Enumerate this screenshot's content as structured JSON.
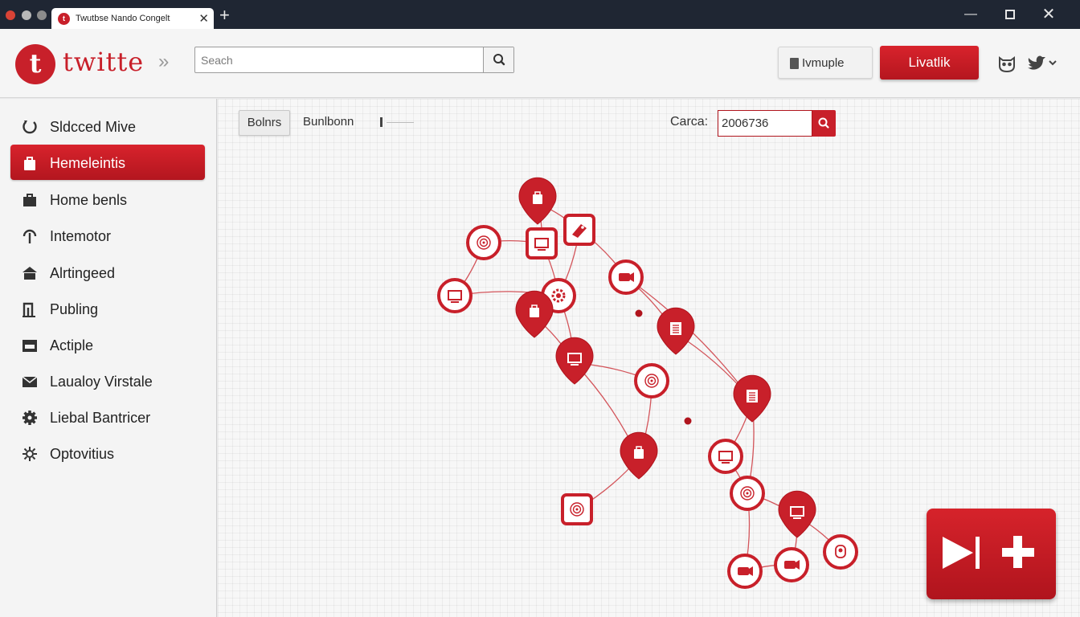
{
  "window": {
    "tab_title": "Twutbse Nando Congelt",
    "favicon_letter": "t",
    "close_glyph": "✕",
    "new_tab_glyph": "+",
    "minimize_glyph": "—"
  },
  "header": {
    "logo_letter": "t",
    "logo_text": "twitte",
    "chevrons": "»",
    "search_placeholder": "Seach",
    "grey_button_label": "Ivmuple",
    "red_button_label": "Livatlik",
    "icons": [
      "owl-icon",
      "bird-icon"
    ]
  },
  "sidebar": {
    "items": [
      {
        "label": "Sldcced Mive",
        "icon": "circle-arrow-icon",
        "active": false
      },
      {
        "label": "Hemeleintis",
        "icon": "bag-icon",
        "active": true
      },
      {
        "label": "Home benls",
        "icon": "briefcase-icon",
        "active": false
      },
      {
        "label": "Intemotor",
        "icon": "pin-icon",
        "active": false
      },
      {
        "label": "Alrtingeed",
        "icon": "house-icon",
        "active": false
      },
      {
        "label": "Publing",
        "icon": "chart-icon",
        "active": false
      },
      {
        "label": "Actiple",
        "icon": "tray-icon",
        "active": false
      },
      {
        "label": "Laualoy Virstale",
        "icon": "mail-icon",
        "active": false
      },
      {
        "label": "Liebal Bantricer",
        "icon": "gear-icon",
        "active": false
      },
      {
        "label": "Optovitius",
        "icon": "sun-icon",
        "active": false
      }
    ]
  },
  "toolbar": {
    "button_label": "Bolnrs",
    "label": "Bunlbonn",
    "category_label": "Carca:",
    "category_value": "2006736"
  },
  "graph": {
    "nodes": [
      {
        "id": "n1",
        "shape": "pin",
        "icon": "bag-icon"
      },
      {
        "id": "n2",
        "shape": "ring",
        "icon": "swirl-icon"
      },
      {
        "id": "n3",
        "shape": "square",
        "icon": "screen-icon"
      },
      {
        "id": "n4",
        "shape": "square",
        "icon": "tag-icon"
      },
      {
        "id": "n5",
        "shape": "ring",
        "icon": "screen-icon"
      },
      {
        "id": "n6",
        "shape": "ring",
        "icon": "gear-icon"
      },
      {
        "id": "n7",
        "shape": "ring",
        "icon": "camera-icon"
      },
      {
        "id": "n8",
        "shape": "pin",
        "icon": "bag-icon"
      },
      {
        "id": "n9",
        "shape": "pin",
        "icon": "document-icon"
      },
      {
        "id": "n10",
        "shape": "pin",
        "icon": "screen-icon"
      },
      {
        "id": "n11",
        "shape": "ring",
        "icon": "swirl-icon"
      },
      {
        "id": "n12",
        "shape": "pin",
        "icon": "document-icon"
      },
      {
        "id": "n13",
        "shape": "pin",
        "icon": "bag-icon"
      },
      {
        "id": "n14",
        "shape": "ring",
        "icon": "screen-icon"
      },
      {
        "id": "n15",
        "shape": "square",
        "icon": "swirl-icon"
      },
      {
        "id": "n16",
        "shape": "ring",
        "icon": "swirl-icon"
      },
      {
        "id": "n17",
        "shape": "pin",
        "icon": "screen-icon"
      },
      {
        "id": "n18",
        "shape": "ring",
        "icon": "user-icon"
      },
      {
        "id": "n19",
        "shape": "ring",
        "icon": "camera-icon"
      },
      {
        "id": "n20",
        "shape": "ring",
        "icon": "camera-icon"
      }
    ],
    "edges": [
      [
        "n1",
        "n3"
      ],
      [
        "n1",
        "n4"
      ],
      [
        "n2",
        "n3"
      ],
      [
        "n2",
        "n5"
      ],
      [
        "n3",
        "n6"
      ],
      [
        "n4",
        "n6"
      ],
      [
        "n4",
        "n7"
      ],
      [
        "n5",
        "n6"
      ],
      [
        "n6",
        "n8"
      ],
      [
        "n6",
        "n10"
      ],
      [
        "n7",
        "n9"
      ],
      [
        "n7",
        "n12"
      ],
      [
        "n8",
        "n10"
      ],
      [
        "n10",
        "n11"
      ],
      [
        "n10",
        "n13"
      ],
      [
        "n11",
        "n13"
      ],
      [
        "n13",
        "n15"
      ],
      [
        "n12",
        "n14"
      ],
      [
        "n12",
        "n16"
      ],
      [
        "n14",
        "n16"
      ],
      [
        "n16",
        "n17"
      ],
      [
        "n17",
        "n18"
      ],
      [
        "n17",
        "n20"
      ],
      [
        "n16",
        "n19"
      ],
      [
        "n19",
        "n20"
      ],
      [
        "n9",
        "n12"
      ]
    ]
  },
  "fab": {
    "icons": [
      "play-icon",
      "plus-icon"
    ]
  },
  "colors": {
    "accent": "#c8202a",
    "accent_dark": "#b0141d"
  }
}
